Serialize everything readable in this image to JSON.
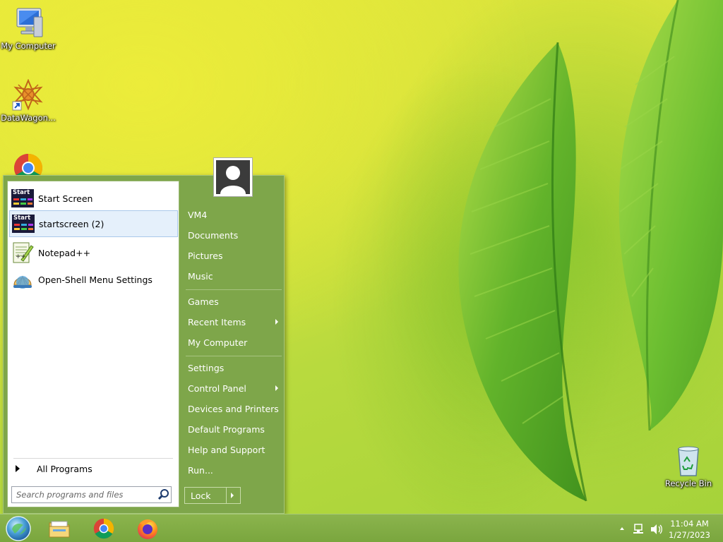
{
  "desktop": {
    "icons": [
      {
        "label": "My Computer"
      },
      {
        "label": "DataWagon..."
      },
      {
        "label": "Google Chrome"
      },
      {
        "label": "Recycle Bin"
      }
    ]
  },
  "start_menu": {
    "programs": [
      {
        "label": "Start Screen",
        "icon": "startscreen-icon"
      },
      {
        "label": "startscreen (2)",
        "icon": "startscreen-icon",
        "selected": true
      },
      {
        "label": "Notepad++",
        "icon": "notepadpp-icon"
      },
      {
        "label": "Open-Shell Menu Settings",
        "icon": "openshell-icon"
      }
    ],
    "start_icon_text": "Start",
    "all_programs": "All Programs",
    "search_placeholder": "Search programs and files",
    "right_items": [
      {
        "label": "VM4"
      },
      {
        "label": "Documents"
      },
      {
        "label": "Pictures"
      },
      {
        "label": "Music"
      },
      {
        "label": "Games"
      },
      {
        "label": "Recent Items",
        "submenu": true
      },
      {
        "label": "My Computer"
      },
      {
        "label": "Settings"
      },
      {
        "label": "Control Panel",
        "submenu": true
      },
      {
        "label": "Devices and Printers"
      },
      {
        "label": "Default Programs"
      },
      {
        "label": "Help and Support"
      },
      {
        "label": "Run..."
      }
    ],
    "lock_label": "Lock"
  },
  "taskbar": {
    "pinned": [
      "file-explorer-icon",
      "chrome-icon",
      "firefox-icon"
    ],
    "clock": {
      "time": "11:04 AM",
      "date": "1/27/2023"
    }
  },
  "colors": {
    "menu_green": "#7ea64a",
    "taskbar_green": "#80ab44",
    "selection": "#e5f0fb"
  }
}
